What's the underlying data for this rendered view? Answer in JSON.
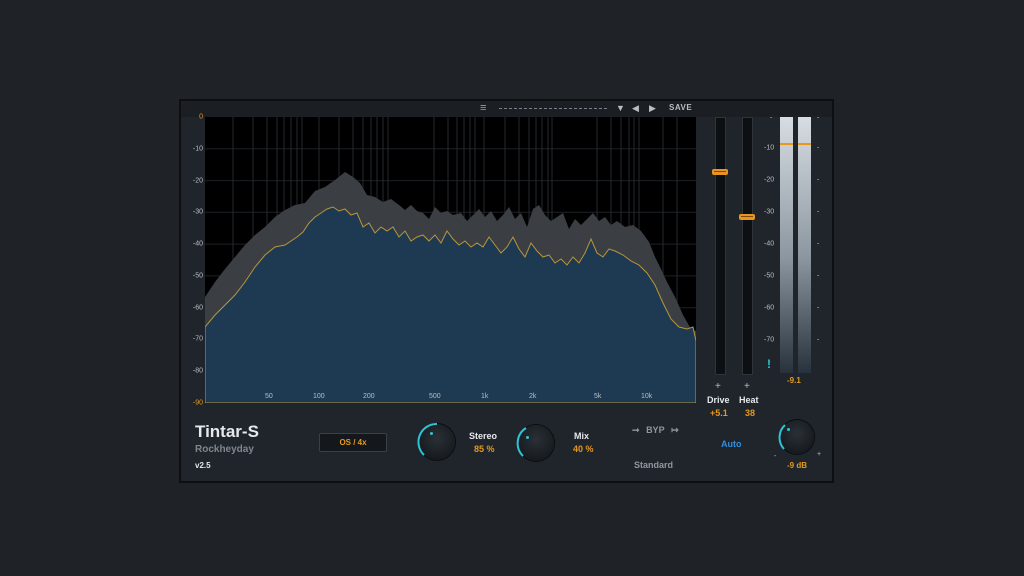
{
  "topbar": {
    "menu_glyph": "≡",
    "preset_dropdown_glyph": "▼",
    "prev_glyph": "◀",
    "next_glyph": "▶",
    "save_label": "SAVE"
  },
  "analyzer": {
    "db_labels": [
      "0",
      "-10",
      "-20",
      "-30",
      "-40",
      "-50",
      "-60",
      "-70",
      "-80",
      "-90"
    ],
    "freq_labels": [
      "50",
      "100",
      "200",
      "500",
      "1k",
      "2k",
      "5k",
      "10k"
    ]
  },
  "faders": {
    "drive": {
      "plus": "+",
      "label": "Drive",
      "value": "+5.1"
    },
    "heat": {
      "plus": "+",
      "label": "Heat",
      "value": "38"
    }
  },
  "meter": {
    "scale": [
      "-",
      "-10",
      "-20",
      "-30",
      "-40",
      "-50",
      "-60",
      "-70"
    ],
    "readout": "-9.1",
    "warning_glyph": "!",
    "output_knob_value": "-9 dB",
    "min_glyph": "-",
    "max_glyph": "+"
  },
  "branding": {
    "title": "Tintar-S",
    "maker": "Rockheyday",
    "version": "v2.5"
  },
  "controls": {
    "os_button": "OS / 4x",
    "stereo": {
      "label": "Stereo",
      "value": "85 %"
    },
    "mix": {
      "label": "Mix",
      "value": "40 %"
    },
    "bypass_label": "BYP",
    "bypass_arrow_left": "➞",
    "bypass_arrow_right": "↦",
    "mode": "Standard",
    "auto": "Auto"
  },
  "colors": {
    "accent": "#e59a1e",
    "knob_accent": "#2ec4d6",
    "auto_blue": "#2e8fe0",
    "spectrum_fill": "#1e3a52",
    "spectrum_peak": "#3b3f44"
  }
}
